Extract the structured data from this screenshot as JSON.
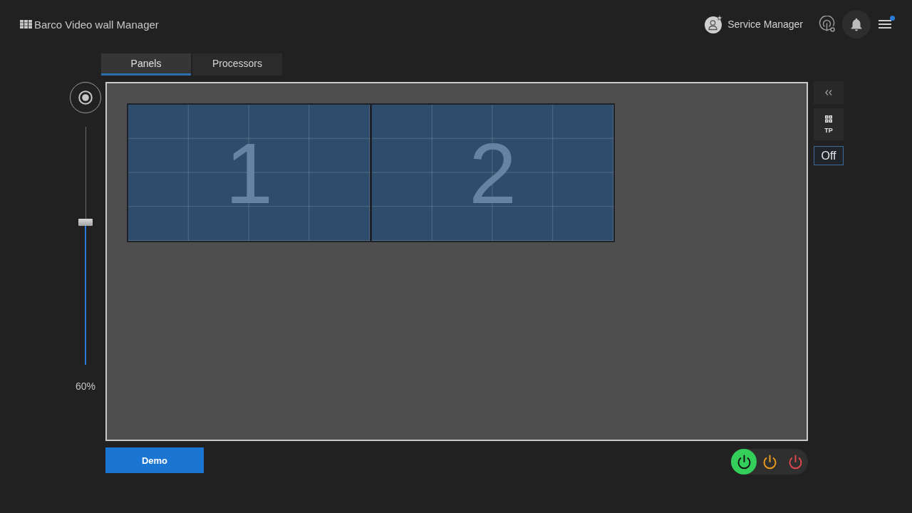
{
  "header": {
    "title": "Barco Video wall Manager",
    "user": "Service Manager",
    "menu_dot": true
  },
  "tabs": [
    {
      "label": "Panels",
      "selected": true
    },
    {
      "label": "Processors",
      "selected": false
    }
  ],
  "zoom": {
    "level": 0.6,
    "reading": "60%"
  },
  "wall": {
    "panels": [
      {
        "number": "1"
      },
      {
        "number": "2"
      }
    ]
  },
  "side_tools": {
    "tp_label": "TP",
    "mode": "Off"
  },
  "demo_button": {
    "label": "Demo"
  },
  "power_buttons": [
    {
      "selected": true,
      "color": "#34cf5a"
    },
    {
      "selected": false,
      "color": "#e89b1c"
    },
    {
      "selected": false,
      "color": "#e0474c"
    }
  ]
}
